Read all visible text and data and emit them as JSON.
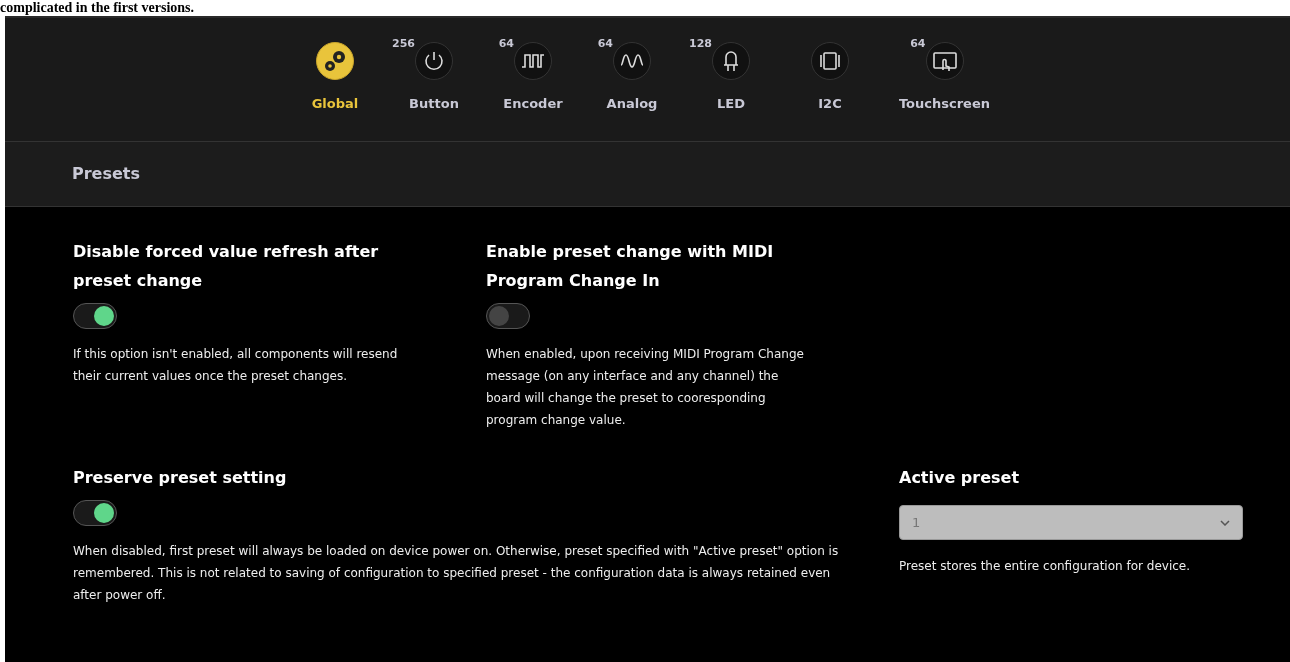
{
  "page_heading": "complicated in the first versions.",
  "tabs": [
    {
      "label": "Global",
      "selected": true
    },
    {
      "label": "Button",
      "count": "256",
      "selected": false
    },
    {
      "label": "Encoder",
      "count": "64",
      "selected": false
    },
    {
      "label": "Analog",
      "count": "64",
      "selected": false
    },
    {
      "label": "LED",
      "count": "128",
      "selected": false
    },
    {
      "label": "I2C",
      "selected": false
    },
    {
      "label": "Touchscreen",
      "count": "64",
      "selected": false
    }
  ],
  "section": {
    "title": "Presets"
  },
  "settings": [
    {
      "kind": "toggle",
      "title": "Disable forced value refresh after preset change",
      "on": true,
      "help": "If this option isn't enabled, all components will resend their current values once the preset changes."
    },
    {
      "kind": "toggle",
      "title": "Enable preset change with MIDI Program Change In",
      "on": false,
      "help": "When enabled, upon receiving MIDI Program Change message (on any interface and any channel) the board will change the preset to cooresponding program change value."
    },
    {
      "kind": "toggle",
      "title": "Preserve preset setting",
      "on": true,
      "help": "When disabled, first preset will always be loaded on device power on. Otherwise, preset specified with \"Active preset\" option is remembered. This is not related to saving of configuration to specified preset - the configuration data is always retained even after power off."
    },
    {
      "kind": "select",
      "title": "Active preset",
      "value": "1",
      "disabled": true,
      "help": "Preset stores the entire configuration for device."
    }
  ]
}
